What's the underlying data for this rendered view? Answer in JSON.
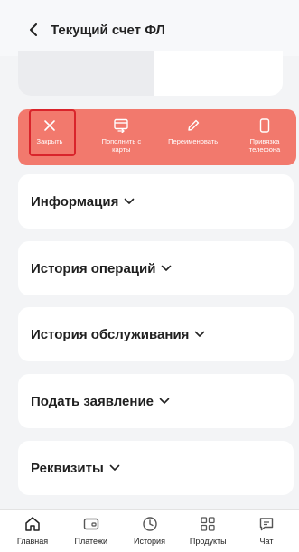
{
  "header": {
    "title": "Текущий счет ФЛ",
    "back_icon": "chevron-left-icon"
  },
  "actions": [
    {
      "label": "Закрыть",
      "icon": "close-icon"
    },
    {
      "label": "Пополнить с карты",
      "icon": "card-transfer-icon"
    },
    {
      "label": "Переименовать",
      "icon": "pencil-icon"
    },
    {
      "label": "Привязка телефона",
      "icon": "phone-icon"
    }
  ],
  "sections": [
    {
      "label": "Информация"
    },
    {
      "label": "История операций"
    },
    {
      "label": "История обслуживания"
    },
    {
      "label": "Подать заявление"
    },
    {
      "label": "Реквизиты"
    }
  ],
  "nav": [
    {
      "label": "Главная",
      "icon": "home-icon"
    },
    {
      "label": "Платежи",
      "icon": "payments-icon"
    },
    {
      "label": "История",
      "icon": "clock-icon"
    },
    {
      "label": "Продукты",
      "icon": "grid-icon"
    },
    {
      "label": "Чат",
      "icon": "chat-icon"
    }
  ],
  "colors": {
    "action_bar": "#f2796d",
    "selected_outline": "#d9242b",
    "background": "#f3f4f6"
  }
}
